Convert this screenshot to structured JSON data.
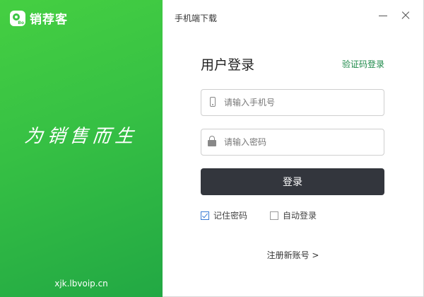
{
  "brand": {
    "logo_badge": "Bo",
    "name": "销荐客",
    "slogan": "为销售而生",
    "site": "xjk.lbvoip.cn"
  },
  "header": {
    "mobile_download": "手机端下载"
  },
  "login": {
    "title": "用户登录",
    "sms_login": "验证码登录",
    "phone": {
      "placeholder": "请输入手机号",
      "value": ""
    },
    "password": {
      "placeholder": "请输入密码",
      "value": ""
    },
    "submit": "登录",
    "remember_password": {
      "label": "记住密码",
      "checked": true
    },
    "auto_login": {
      "label": "自动登录",
      "checked": false
    },
    "register": "注册新账号 >"
  },
  "colors": {
    "brand_green": "#3cc545",
    "button_dark": "#33363d",
    "link_green": "#1e8a4a"
  }
}
